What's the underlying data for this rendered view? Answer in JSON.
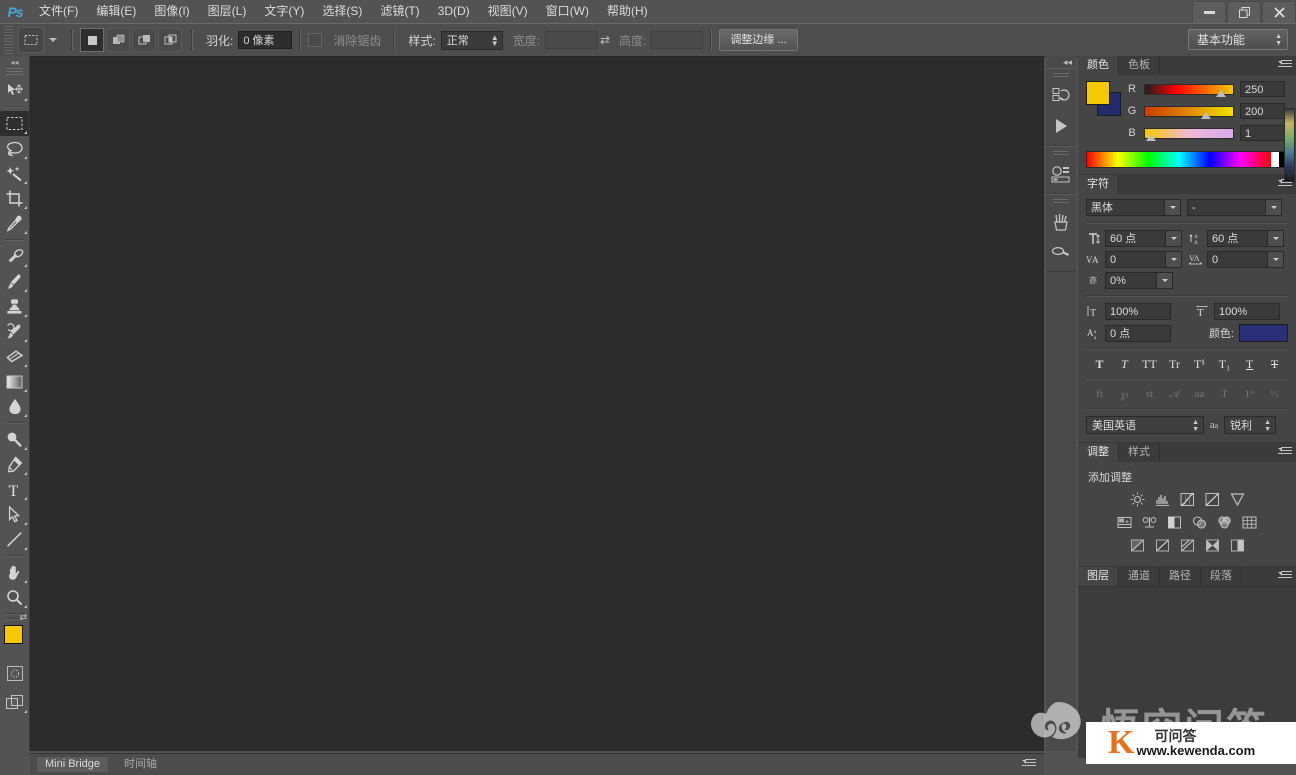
{
  "app": {
    "logo": "Ps",
    "workspace": "基本功能"
  },
  "menubar": {
    "items": [
      {
        "label": "文件(F)"
      },
      {
        "label": "编辑(E)"
      },
      {
        "label": "图像(I)"
      },
      {
        "label": "图层(L)"
      },
      {
        "label": "文字(Y)"
      },
      {
        "label": "选择(S)"
      },
      {
        "label": "滤镜(T)"
      },
      {
        "label": "3D(D)"
      },
      {
        "label": "视图(V)"
      },
      {
        "label": "窗口(W)"
      },
      {
        "label": "帮助(H)"
      }
    ],
    "window_controls": {
      "minimize": "—",
      "restore": "❐",
      "close": "✕"
    }
  },
  "options_bar": {
    "feather_label": "羽化:",
    "feather_value": "0 像素",
    "antialias_label": "消除锯齿",
    "style_label": "样式:",
    "style_value": "正常",
    "width_label": "宽度:",
    "width_value": "",
    "height_label": "高度:",
    "height_value": "",
    "refine_edge": "调整边缘 ..."
  },
  "toolbar": {
    "tools": [
      {
        "name": "move-tool",
        "glyph": "move"
      },
      {
        "name": "marquee-tool",
        "glyph": "marquee",
        "active": true
      },
      {
        "name": "lasso-tool",
        "glyph": "lasso"
      },
      {
        "name": "magic-wand-tool",
        "glyph": "wand"
      },
      {
        "name": "crop-tool",
        "glyph": "crop"
      },
      {
        "name": "eyedropper-tool",
        "glyph": "eyedropper"
      },
      {
        "name": "healing-brush-tool",
        "glyph": "heal"
      },
      {
        "name": "brush-tool",
        "glyph": "brush"
      },
      {
        "name": "clone-stamp-tool",
        "glyph": "stamp"
      },
      {
        "name": "history-brush-tool",
        "glyph": "historybrush"
      },
      {
        "name": "eraser-tool",
        "glyph": "eraser"
      },
      {
        "name": "gradient-tool",
        "glyph": "gradient"
      },
      {
        "name": "blur-tool",
        "glyph": "blur"
      },
      {
        "name": "dodge-tool",
        "glyph": "dodge"
      },
      {
        "name": "pen-tool",
        "glyph": "pen"
      },
      {
        "name": "type-tool",
        "glyph": "type"
      },
      {
        "name": "path-selection-tool",
        "glyph": "pathselect"
      },
      {
        "name": "line-tool",
        "glyph": "line"
      },
      {
        "name": "hand-tool",
        "glyph": "hand"
      },
      {
        "name": "zoom-tool",
        "glyph": "zoom"
      }
    ],
    "foreground_color": "#F5C800",
    "background_color": "#232C6B"
  },
  "dock": {
    "items": [
      {
        "name": "history-panel-icon"
      },
      {
        "name": "actions-panel-icon"
      },
      {
        "name": "mini-bridge-panel-icon"
      },
      {
        "name": "brush-presets-panel-icon"
      },
      {
        "name": "brush-panel-icon"
      }
    ]
  },
  "color_panel": {
    "tabs": [
      {
        "label": "颜色",
        "active": true
      },
      {
        "label": "色板",
        "active": false
      }
    ],
    "channels": [
      {
        "label": "R",
        "value": "250",
        "pct": 98
      },
      {
        "label": "G",
        "value": "200",
        "pct": 78
      },
      {
        "label": "B",
        "value": "1",
        "pct": 1
      }
    ],
    "foreground_color": "#F5C800",
    "background_color": "#232C6B"
  },
  "character_panel": {
    "tabs": [
      {
        "label": "字符",
        "active": true
      }
    ],
    "font_family": "黑体",
    "font_style": "-",
    "font_size": "60 点",
    "leading": "60 点",
    "kerning": "0",
    "tracking": "0",
    "vertical_scale_pct": "0%",
    "scale_v": "100%",
    "scale_h": "100%",
    "baseline_shift": "0 点",
    "color_label": "颜色:",
    "text_color": "#2A2F7A",
    "style_buttons": [
      "T",
      "T",
      "TT",
      "Tr",
      "T¹",
      "T₁",
      "T",
      "T"
    ],
    "opentype_buttons": [
      "fi",
      "℘",
      "st",
      "𝒜",
      "aa",
      "T",
      "1ˢᵗ",
      "½"
    ],
    "language": "美国英语",
    "antialias_method": "锐利"
  },
  "adjustments_panel": {
    "tabs": [
      {
        "label": "调整",
        "active": true
      },
      {
        "label": "样式",
        "active": false
      }
    ],
    "heading": "添加调整",
    "row1": [
      "brightness-contrast-icon",
      "levels-icon",
      "curves-icon",
      "exposure-icon",
      "vibrance-icon"
    ],
    "row2": [
      "hue-saturation-icon",
      "color-balance-icon",
      "black-white-icon",
      "photo-filter-icon",
      "channel-mixer-icon",
      "color-lookup-icon"
    ],
    "row3": [
      "invert-icon",
      "posterize-icon",
      "threshold-icon",
      "gradient-map-icon",
      "selective-color-icon"
    ]
  },
  "layers_panel": {
    "tabs": [
      {
        "label": "图层",
        "active": true
      },
      {
        "label": "通道",
        "active": false
      },
      {
        "label": "路径",
        "active": false
      },
      {
        "label": "段落",
        "active": false
      }
    ]
  },
  "status_bar": {
    "tabs": [
      {
        "label": "Mini Bridge",
        "active": true
      },
      {
        "label": "时间轴",
        "active": false
      }
    ]
  },
  "watermark": {
    "main_text": "悟空问答",
    "badge_letter": "K",
    "badge_cn": "可问答",
    "badge_url": "www.kewenda.com"
  }
}
